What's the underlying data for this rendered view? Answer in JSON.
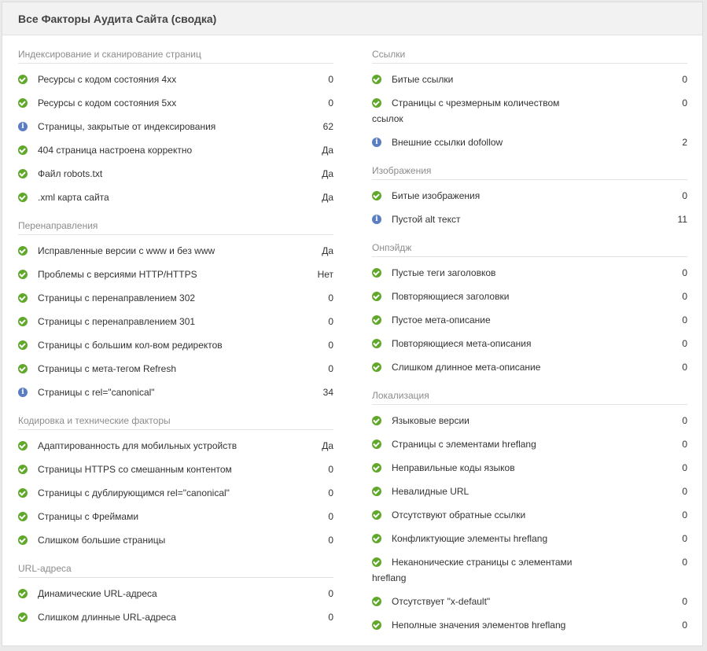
{
  "title": "Все Факторы Аудита Сайта (сводка)",
  "colors": {
    "ok": "#5fa82a",
    "info": "#5b7ec2"
  },
  "left": [
    {
      "title": "Индексирование и сканирование страниц",
      "rows": [
        {
          "icon": "ok",
          "line1": "Ресурсы с кодом состояния 4xx",
          "value": "0"
        },
        {
          "icon": "ok",
          "line1": "Ресурсы с кодом состояния 5xx",
          "value": "0"
        },
        {
          "icon": "info",
          "line1": "Страницы, закрытые от индексирования",
          "value": "62"
        },
        {
          "icon": "ok",
          "line1": "404 страница настроена корректно",
          "value": "Да"
        },
        {
          "icon": "ok",
          "line1": "Файл robots.txt",
          "value": "Да"
        },
        {
          "icon": "ok",
          "line1": ".xml карта сайта",
          "value": "Да"
        }
      ]
    },
    {
      "title": "Перенаправления",
      "rows": [
        {
          "icon": "ok",
          "line1": "Исправленные версии с www и без www",
          "value": "Да"
        },
        {
          "icon": "ok",
          "line1": "Проблемы с версиями HTTP/HTTPS",
          "value": "Нет"
        },
        {
          "icon": "ok",
          "line1": "Страницы с перенаправлением 302",
          "value": "0"
        },
        {
          "icon": "ok",
          "line1": "Страницы с перенаправлением 301",
          "value": "0"
        },
        {
          "icon": "ok",
          "line1": "Страницы с большим кол-вом редиректов",
          "value": "0"
        },
        {
          "icon": "ok",
          "line1": "Страницы с мета-тегом Refresh",
          "value": "0"
        },
        {
          "icon": "info",
          "line1": "Страницы с rel=\"canonical\"",
          "value": "34"
        }
      ]
    },
    {
      "title": "Кодировка и технические факторы",
      "rows": [
        {
          "icon": "ok",
          "line1": "Адаптированность для мобильных устройств",
          "value": "Да"
        },
        {
          "icon": "ok",
          "line1": "Страницы HTTPS со смешанным контентом",
          "value": "0"
        },
        {
          "icon": "ok",
          "line1": "Страницы с дублирующимся rel=\"canonical\"",
          "value": "0"
        },
        {
          "icon": "ok",
          "line1": "Страницы с Фреймами",
          "value": "0"
        },
        {
          "icon": "ok",
          "line1": "Слишком большие страницы",
          "value": "0"
        }
      ]
    },
    {
      "title": "URL-адреса",
      "rows": [
        {
          "icon": "ok",
          "line1": "Динамические URL-адреса",
          "value": "0"
        },
        {
          "icon": "ok",
          "line1": "Слишком длинные URL-адреса",
          "value": "0"
        }
      ]
    }
  ],
  "right": [
    {
      "title": "Ссылки",
      "rows": [
        {
          "icon": "ok",
          "line1": "Битые ссылки",
          "value": "0"
        },
        {
          "icon": "ok",
          "line1": "Страницы с чрезмерным количеством",
          "line2": "ссылок",
          "value": "0"
        },
        {
          "icon": "info",
          "line1": "Внешние ссылки dofollow",
          "value": "2"
        }
      ]
    },
    {
      "title": "Изображения",
      "rows": [
        {
          "icon": "ok",
          "line1": "Битые изображения",
          "value": "0"
        },
        {
          "icon": "info",
          "line1": "Пустой alt текст",
          "value": "11"
        }
      ]
    },
    {
      "title": "Онпэйдж",
      "rows": [
        {
          "icon": "ok",
          "line1": "Пустые теги заголовков",
          "value": "0"
        },
        {
          "icon": "ok",
          "line1": "Повторяющиеся заголовки",
          "value": "0"
        },
        {
          "icon": "ok",
          "line1": "Пустое мета-описание",
          "value": "0"
        },
        {
          "icon": "ok",
          "line1": "Повторяющиеся мета-описания",
          "value": "0"
        },
        {
          "icon": "ok",
          "line1": "Слишком длинное мета-описание",
          "value": "0"
        }
      ]
    },
    {
      "title": "Локализация",
      "rows": [
        {
          "icon": "ok",
          "line1": "Языковые версии",
          "value": "0"
        },
        {
          "icon": "ok",
          "line1": "Страницы с элементами hreflang",
          "value": "0"
        },
        {
          "icon": "ok",
          "line1": "Неправильные коды языков",
          "value": "0"
        },
        {
          "icon": "ok",
          "line1": "Невалидные URL",
          "value": "0"
        },
        {
          "icon": "ok",
          "line1": "Отсутствуют обратные ссылки",
          "value": "0"
        },
        {
          "icon": "ok",
          "line1": "Конфликтующие элементы hreflang",
          "value": "0"
        },
        {
          "icon": "ok",
          "line1": "Неканонические страницы с элементами",
          "line2": "hreflang",
          "value": "0"
        },
        {
          "icon": "ok",
          "line1": "Отсутствует \"x-default\"",
          "value": "0"
        },
        {
          "icon": "ok",
          "line1": "Неполные значения элементов hreflang",
          "value": "0"
        }
      ]
    }
  ]
}
